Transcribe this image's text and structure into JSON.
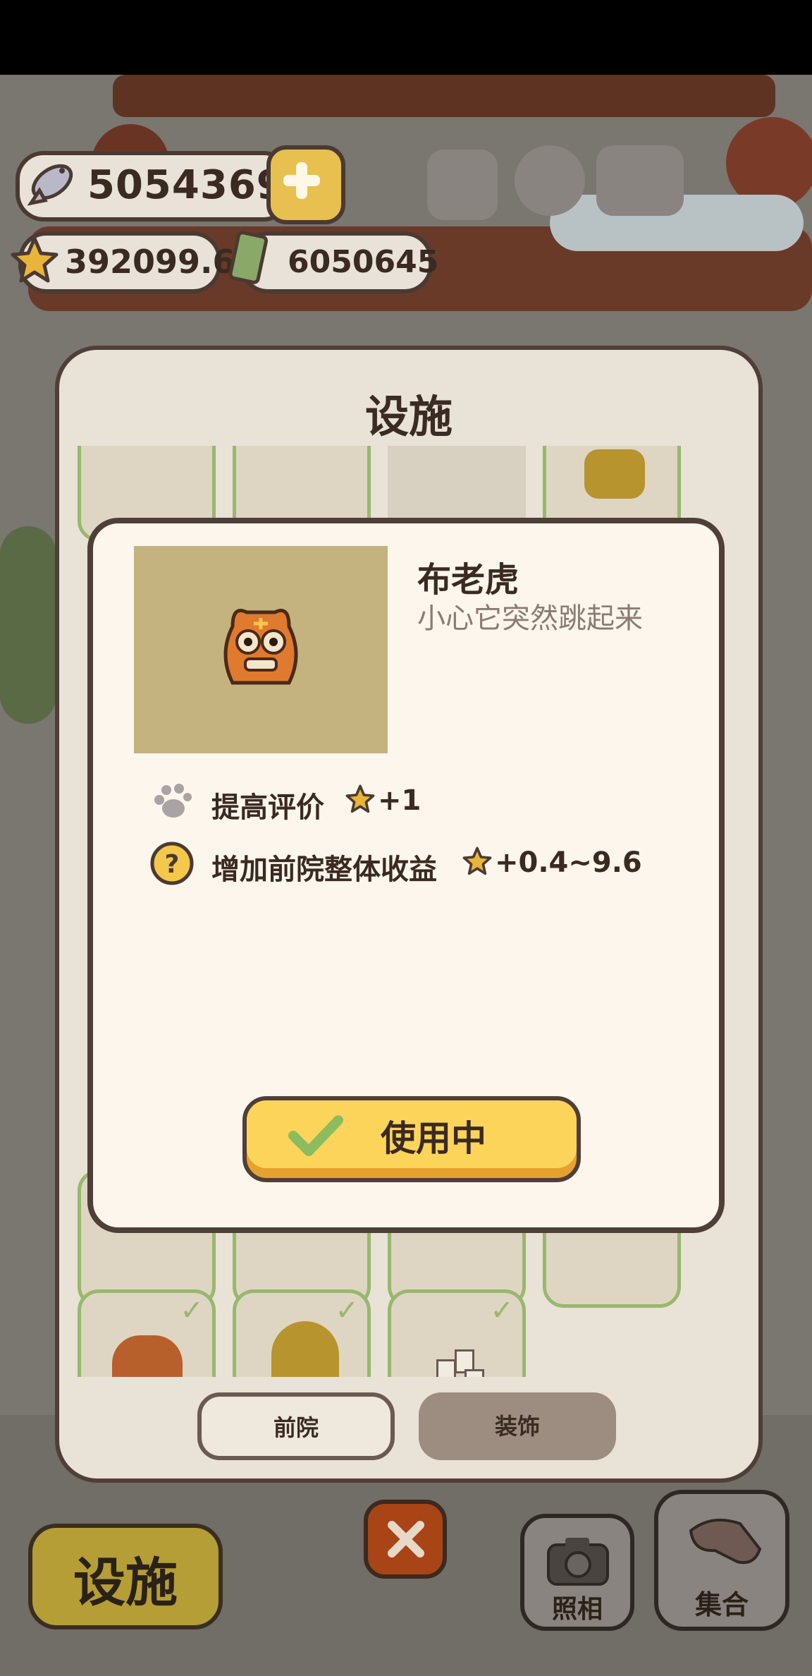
{
  "hud": {
    "fish_count": "5054369",
    "star_rating": "392099.6",
    "cash": "6050645"
  },
  "panel": {
    "title": "设施",
    "tabs": [
      {
        "label": "前院"
      },
      {
        "label": "装饰"
      }
    ]
  },
  "detail": {
    "name": "布老虎",
    "description": "小心它突然跳起来",
    "stats": [
      {
        "label": "提高评价",
        "bonus": "+1"
      },
      {
        "label": "增加前院整体收益",
        "bonus": "+0.4~9.6"
      }
    ],
    "use_button": "使用中"
  },
  "bottom": {
    "facility_button": "设施",
    "camera_label": "照相",
    "gather_label": "集合"
  },
  "colors": {
    "accent_yellow": "#fdd45a",
    "check_green": "#98b86e",
    "close_orange": "#a84416"
  }
}
